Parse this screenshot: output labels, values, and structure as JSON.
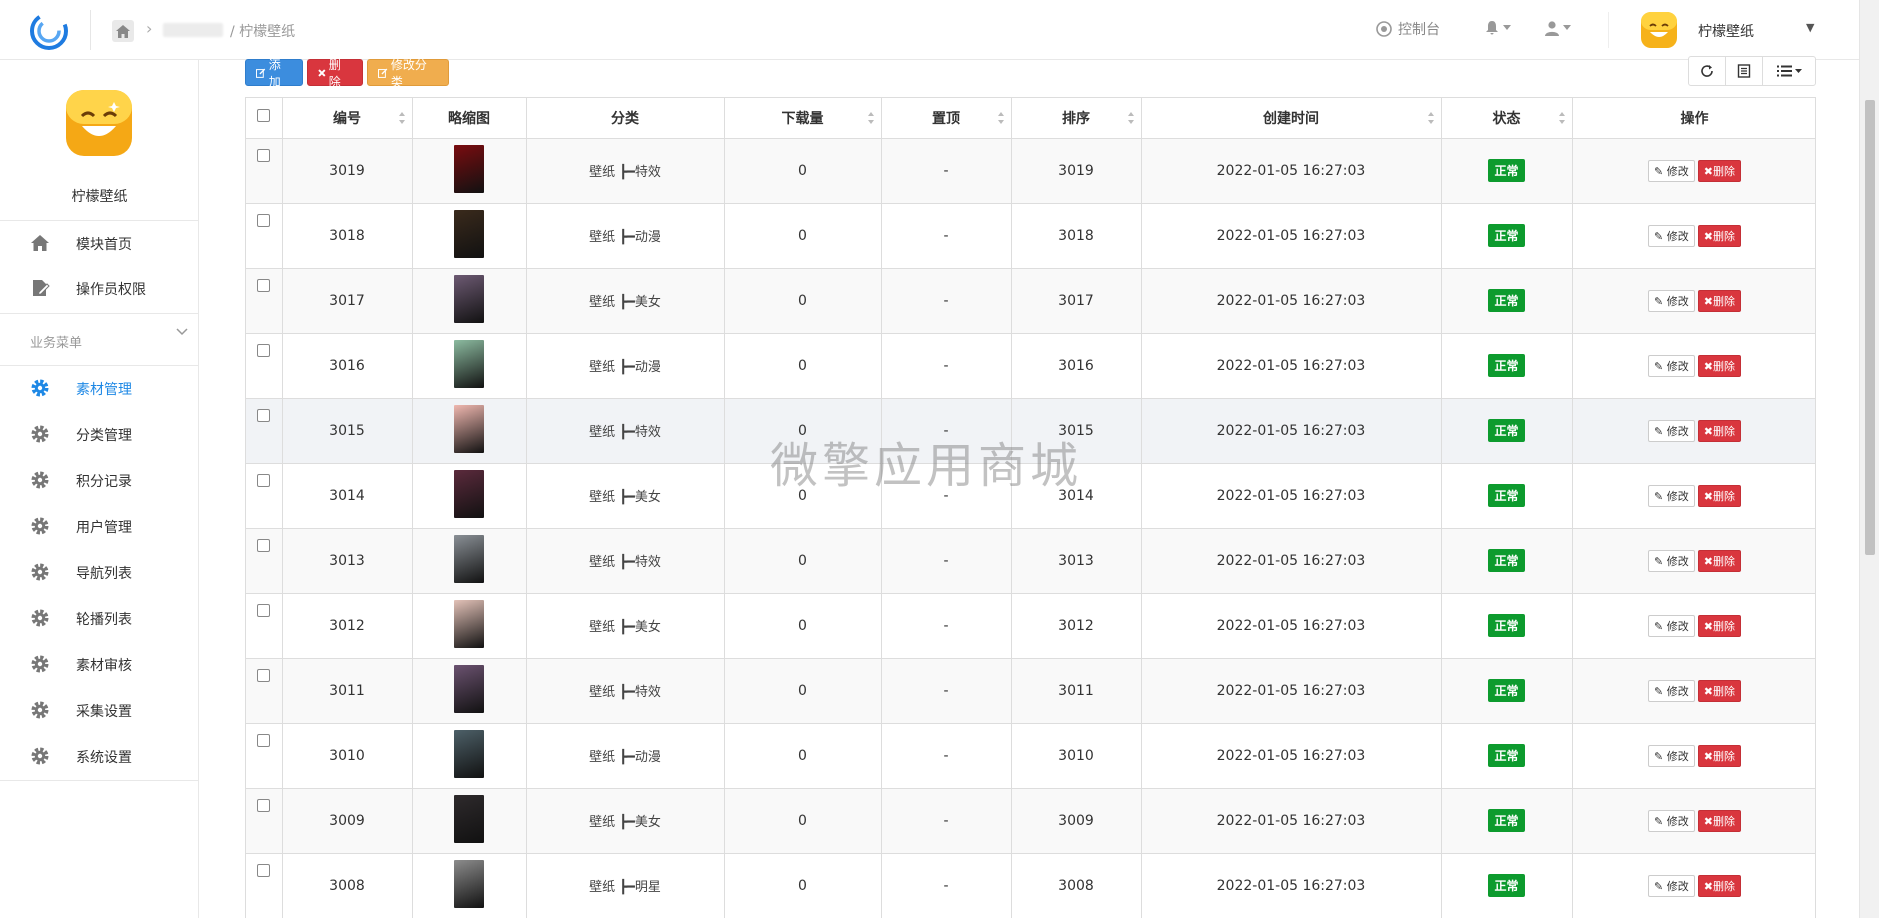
{
  "header": {
    "breadcrumb_current": "/ 柠檬壁纸",
    "console_label": "控制台",
    "user_name": "柠檬壁纸"
  },
  "sidebar": {
    "profile_name": "柠檬壁纸",
    "top_items": [
      {
        "label": "模块首页",
        "icon": "home-icon"
      },
      {
        "label": "操作员权限",
        "icon": "edit-document-icon"
      }
    ],
    "section_title": "业务菜单",
    "items": [
      {
        "label": "素材管理",
        "icon": "gear-icon",
        "active": true
      },
      {
        "label": "分类管理",
        "icon": "gear-icon"
      },
      {
        "label": "积分记录",
        "icon": "gear-icon"
      },
      {
        "label": "用户管理",
        "icon": "gear-icon"
      },
      {
        "label": "导航列表",
        "icon": "gear-icon"
      },
      {
        "label": "轮播列表",
        "icon": "gear-icon"
      },
      {
        "label": "素材审核",
        "icon": "gear-icon"
      },
      {
        "label": "采集设置",
        "icon": "gear-icon"
      },
      {
        "label": "系统设置",
        "icon": "gear-icon"
      }
    ]
  },
  "toolbar": {
    "add_label": "添加",
    "delete_label": "删除",
    "edit_category_label": "修改分类"
  },
  "table": {
    "columns": [
      "编号",
      "略缩图",
      "分类",
      "下载量",
      "置顶",
      "排序",
      "创建时间",
      "状态",
      "操作"
    ],
    "edit_label": "修改",
    "delete_label": "删除",
    "rows": [
      {
        "id": "3019",
        "category": "壁纸 ┣━特效",
        "downloads": "0",
        "pinned": "-",
        "sort": "3019",
        "created": "2022-01-05 16:27:03",
        "status": "正常",
        "thumb": "#7a0c10"
      },
      {
        "id": "3018",
        "category": "壁纸 ┣━动漫",
        "downloads": "0",
        "pinned": "-",
        "sort": "3018",
        "created": "2022-01-05 16:27:03",
        "status": "正常",
        "thumb": "#3a2a1c"
      },
      {
        "id": "3017",
        "category": "壁纸 ┣━美女",
        "downloads": "0",
        "pinned": "-",
        "sort": "3017",
        "created": "2022-01-05 16:27:03",
        "status": "正常",
        "thumb": "#6d5a73"
      },
      {
        "id": "3016",
        "category": "壁纸 ┣━动漫",
        "downloads": "0",
        "pinned": "-",
        "sort": "3016",
        "created": "2022-01-05 16:27:03",
        "status": "正常",
        "thumb": "#8cbba0"
      },
      {
        "id": "3015",
        "category": "壁纸 ┣━特效",
        "downloads": "0",
        "pinned": "-",
        "sort": "3015",
        "created": "2022-01-05 16:27:03",
        "status": "正常",
        "thumb": "#f0b8b0"
      },
      {
        "id": "3014",
        "category": "壁纸 ┣━美女",
        "downloads": "0",
        "pinned": "-",
        "sort": "3014",
        "created": "2022-01-05 16:27:03",
        "status": "正常",
        "thumb": "#5b2a3c"
      },
      {
        "id": "3013",
        "category": "壁纸 ┣━特效",
        "downloads": "0",
        "pinned": "-",
        "sort": "3013",
        "created": "2022-01-05 16:27:03",
        "status": "正常",
        "thumb": "#8a9096"
      },
      {
        "id": "3012",
        "category": "壁纸 ┣━美女",
        "downloads": "0",
        "pinned": "-",
        "sort": "3012",
        "created": "2022-01-05 16:27:03",
        "status": "正常",
        "thumb": "#e3c2b8"
      },
      {
        "id": "3011",
        "category": "壁纸 ┣━特效",
        "downloads": "0",
        "pinned": "-",
        "sort": "3011",
        "created": "2022-01-05 16:27:03",
        "status": "正常",
        "thumb": "#6b5270"
      },
      {
        "id": "3010",
        "category": "壁纸 ┣━动漫",
        "downloads": "0",
        "pinned": "-",
        "sort": "3010",
        "created": "2022-01-05 16:27:03",
        "status": "正常",
        "thumb": "#4d6068"
      },
      {
        "id": "3009",
        "category": "壁纸 ┣━美女",
        "downloads": "0",
        "pinned": "-",
        "sort": "3009",
        "created": "2022-01-05 16:27:03",
        "status": "正常",
        "thumb": "#2e2a2c"
      },
      {
        "id": "3008",
        "category": "壁纸 ┣━明星",
        "downloads": "0",
        "pinned": "-",
        "sort": "3008",
        "created": "2022-01-05 16:27:03",
        "status": "正常",
        "thumb": "#8c8c8c"
      }
    ]
  },
  "watermark": "微擎应用商城",
  "colors": {
    "primary": "#3c8dde",
    "danger": "#d9363e",
    "warning": "#f0ad4e",
    "success": "#0d9b2e",
    "active_menu": "#1e88e5"
  }
}
